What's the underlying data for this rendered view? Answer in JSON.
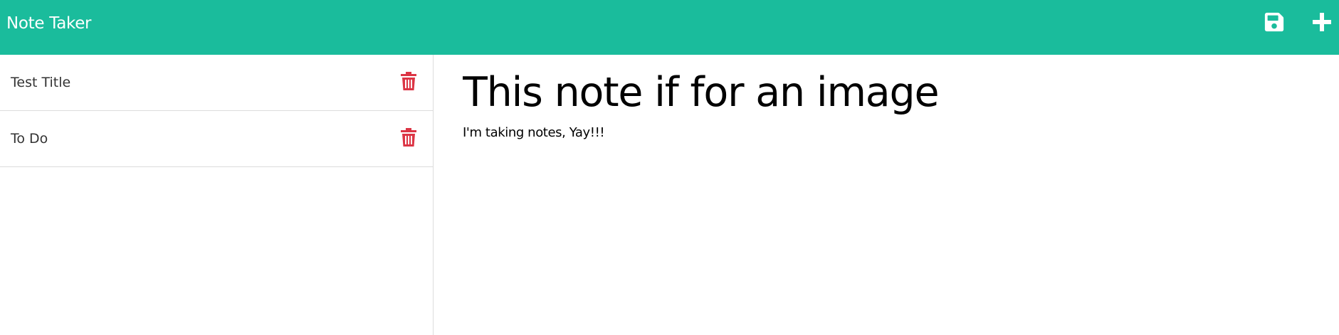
{
  "app": {
    "title": "Note Taker",
    "accent_color": "#1abc9c",
    "delete_color": "#dc3545"
  },
  "toolbar": {
    "save_icon": "floppy-disk-icon",
    "new_icon": "plus-icon"
  },
  "notes": [
    {
      "title": "Test Title",
      "delete_icon": "trash-icon"
    },
    {
      "title": "To Do",
      "delete_icon": "trash-icon"
    }
  ],
  "editor": {
    "title": "This note if for an image",
    "text": "I'm taking notes, Yay!!!"
  }
}
